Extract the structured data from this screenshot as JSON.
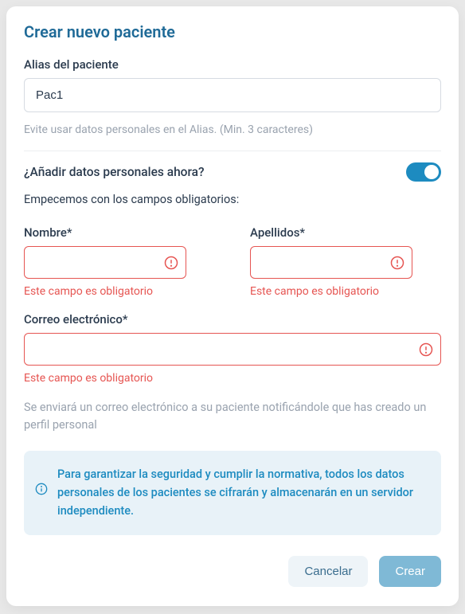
{
  "modal": {
    "title": "Crear nuevo paciente",
    "alias": {
      "label": "Alias del paciente",
      "value": "Pac1",
      "helper": "Evite usar datos personales en el Alias. (Min. 3 caracteres)"
    },
    "personal_toggle": {
      "label": "¿Añadir datos personales ahora?",
      "subtext": "Empecemos con los campos obligatorios:"
    },
    "name": {
      "label": "Nombre*",
      "error": "Este campo es obligatorio"
    },
    "surname": {
      "label": "Apellidos*",
      "error": "Este campo es obligatorio"
    },
    "email": {
      "label": "Correo electrónico*",
      "error": "Este campo es obligatorio"
    },
    "email_notice": "Se enviará un correo electrónico a su paciente notificándole que has creado un perfil personal",
    "security_notice": "Para garantizar la seguridad y cumplir la normativa, todos los datos personales de los pacientes se cifrarán y almacenarán en un servidor independiente.",
    "actions": {
      "cancel": "Cancelar",
      "create": "Crear"
    }
  }
}
